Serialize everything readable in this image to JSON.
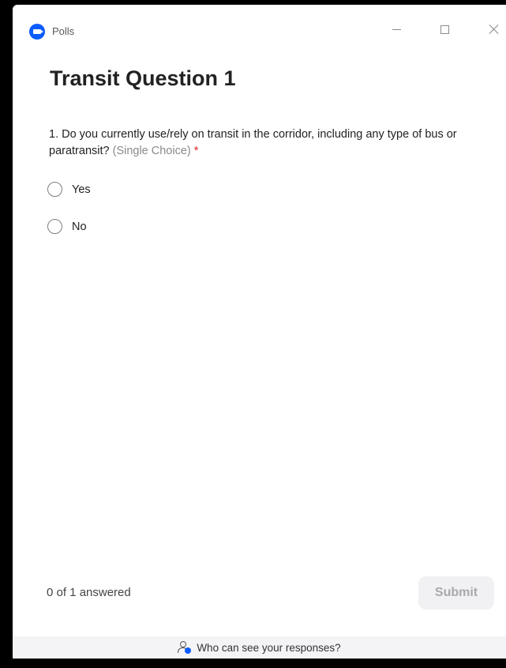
{
  "window": {
    "title": "Polls",
    "logo_icon": "zoom-logo-icon",
    "accent_color": "#0b5cff"
  },
  "poll": {
    "title": "Transit Question 1",
    "question": {
      "text": "1. Do you currently use/rely on transit in the corridor, including any type of bus or paratransit?",
      "type_label": "(Single Choice)",
      "required_marker": "*",
      "options": [
        "Yes",
        "No"
      ]
    }
  },
  "footer_bar": {
    "answered_text": "0 of 1 answered",
    "submit_label": "Submit",
    "privacy_text": "Who can see your responses?",
    "privacy_icon": "person-visibility-icon"
  }
}
